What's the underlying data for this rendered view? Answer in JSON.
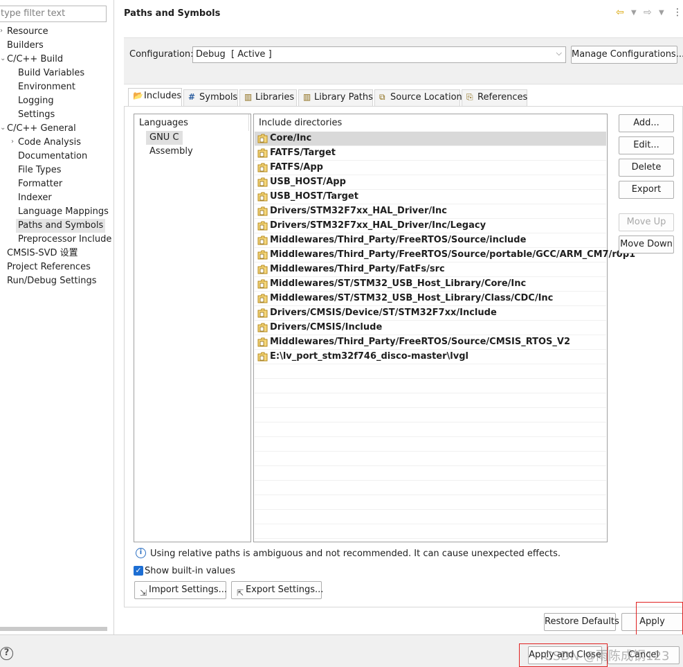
{
  "sidebar": {
    "filter_placeholder": "type filter text",
    "items": [
      {
        "label": "Resource",
        "arrow": ""
      },
      {
        "label": "Builders",
        "arrow": ""
      },
      {
        "label": "C/C++ Build",
        "arrow": ""
      },
      {
        "label": "Build Variables",
        "arrow": ""
      },
      {
        "label": "Environment",
        "arrow": ""
      },
      {
        "label": "Logging",
        "arrow": ""
      },
      {
        "label": "Settings",
        "arrow": ""
      },
      {
        "label": "C/C++ General",
        "arrow": ""
      },
      {
        "label": "Code Analysis",
        "arrow": "›"
      },
      {
        "label": "Documentation",
        "arrow": ""
      },
      {
        "label": "File Types",
        "arrow": ""
      },
      {
        "label": "Formatter",
        "arrow": ""
      },
      {
        "label": "Indexer",
        "arrow": ""
      },
      {
        "label": "Language Mappings",
        "arrow": ""
      },
      {
        "label": "Paths and Symbols",
        "arrow": ""
      },
      {
        "label": "Preprocessor Include",
        "arrow": ""
      },
      {
        "label": "CMSIS-SVD 设置",
        "arrow": ""
      },
      {
        "label": "Project References",
        "arrow": ""
      },
      {
        "label": "Run/Debug Settings",
        "arrow": ""
      }
    ]
  },
  "header": {
    "title": "Paths and Symbols"
  },
  "configuration": {
    "label": "Configuration:",
    "value": "Debug  [ Active ]",
    "manage_button": "Manage Configurations..."
  },
  "tabs": [
    {
      "label": "Includes",
      "icon": "includes-icon"
    },
    {
      "label": "Symbols",
      "icon": "hash-icon"
    },
    {
      "label": "Libraries",
      "icon": "library-icon"
    },
    {
      "label": "Library Paths",
      "icon": "library-path-icon"
    },
    {
      "label": "Source Location",
      "icon": "source-location-icon"
    },
    {
      "label": "References",
      "icon": "references-icon"
    }
  ],
  "languages": {
    "header": "Languages",
    "items": [
      "GNU C",
      "Assembly"
    ]
  },
  "includes": {
    "header": "Include directories",
    "items": [
      "Core/Inc",
      "FATFS/Target",
      "FATFS/App",
      "USB_HOST/App",
      "USB_HOST/Target",
      "Drivers/STM32F7xx_HAL_Driver/Inc",
      "Drivers/STM32F7xx_HAL_Driver/Inc/Legacy",
      "Middlewares/Third_Party/FreeRTOS/Source/include",
      "Middlewares/Third_Party/FreeRTOS/Source/portable/GCC/ARM_CM7/r0p1",
      "Middlewares/Third_Party/FatFs/src",
      "Middlewares/ST/STM32_USB_Host_Library/Core/Inc",
      "Middlewares/ST/STM32_USB_Host_Library/Class/CDC/Inc",
      "Drivers/CMSIS/Device/ST/STM32F7xx/Include",
      "Drivers/CMSIS/Include",
      "Middlewares/Third_Party/FreeRTOS/Source/CMSIS_RTOS_V2",
      "E:\\lv_port_stm32f746_disco-master\\lvgl"
    ]
  },
  "side_buttons": {
    "add": "Add...",
    "edit": "Edit...",
    "delete": "Delete",
    "export": "Export",
    "move_up": "Move Up",
    "move_down": "Move Down"
  },
  "info": {
    "text": "Using relative paths is ambiguous and not recommended. It can cause unexpected effects."
  },
  "show_builtin": {
    "label": "Show built-in values",
    "checked": true
  },
  "import_button": "Import Settings...",
  "export_button": "Export Settings...",
  "restore_defaults": "Restore Defaults",
  "apply": "Apply",
  "apply_and_close": "Apply and Close",
  "cancel": "Cancel",
  "watermark": "CSDN @雨陈成钢123",
  "colors": {
    "highlight_box": "#e02020",
    "accent": "#1d6ed3"
  }
}
